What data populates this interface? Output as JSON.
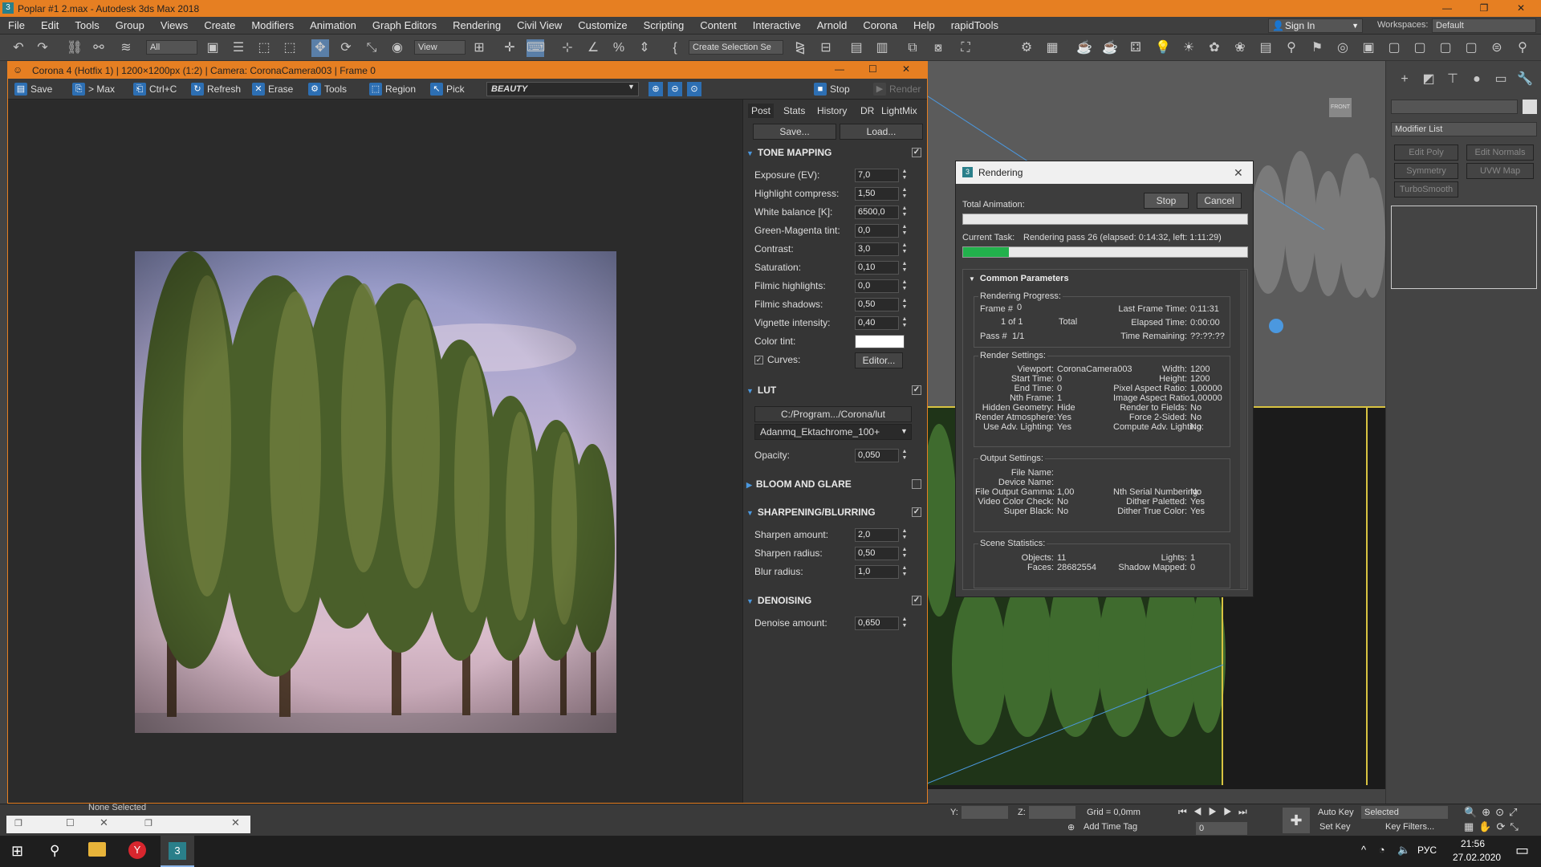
{
  "app": {
    "title": "Poplar #1 2.max - Autodesk 3ds Max 2018",
    "menus": [
      "File",
      "Edit",
      "Tools",
      "Group",
      "Views",
      "Create",
      "Modifiers",
      "Animation",
      "Graph Editors",
      "Rendering",
      "Civil View",
      "Customize",
      "Scripting",
      "Content",
      "Interactive",
      "Arnold",
      "Corona",
      "Help",
      "rapidTools"
    ],
    "sign_in": "Sign In",
    "workspaces_label": "Workspaces:",
    "workspace_value": "Default",
    "selection_filter": "All",
    "view_combo": "View",
    "selection_set": "Create Selection Se"
  },
  "vfb": {
    "title": "Corona 4 (Hotfix 1) | 1200×1200px (1:2) | Camera: CoronaCamera003 | Frame 0",
    "buttons": {
      "save": "Save",
      "max": "> Max",
      "ctrlc": "Ctrl+C",
      "refresh": "Refresh",
      "erase": "Erase",
      "tools": "Tools",
      "region": "Region",
      "pick": "Pick",
      "stop": "Stop",
      "render": "Render"
    },
    "channel": "BEAUTY",
    "tabs": [
      "Post",
      "Stats",
      "History",
      "DR",
      "LightMix"
    ],
    "save_btn": "Save...",
    "load_btn": "Load...",
    "tone_mapping": {
      "title": "TONE MAPPING",
      "rows": [
        {
          "label": "Exposure (EV):",
          "value": "7,0"
        },
        {
          "label": "Highlight compress:",
          "value": "1,50"
        },
        {
          "label": "White balance [K]:",
          "value": "6500,0"
        },
        {
          "label": "Green-Magenta tint:",
          "value": "0,0"
        },
        {
          "label": "Contrast:",
          "value": "3,0"
        },
        {
          "label": "Saturation:",
          "value": "0,10"
        },
        {
          "label": "Filmic highlights:",
          "value": "0,0"
        },
        {
          "label": "Filmic shadows:",
          "value": "0,50"
        },
        {
          "label": "Vignette intensity:",
          "value": "0,40"
        }
      ],
      "color_tint": "Color tint:",
      "curves": "Curves:",
      "editor": "Editor..."
    },
    "lut": {
      "title": "LUT",
      "path": "C:/Program.../Corona/lut",
      "file": "Adanmq_Ektachrome_100+",
      "opacity_label": "Opacity:",
      "opacity": "0,050"
    },
    "bloom": {
      "title": "BLOOM AND GLARE"
    },
    "sharpen": {
      "title": "SHARPENING/BLURRING",
      "rows": [
        {
          "label": "Sharpen amount:",
          "value": "2,0"
        },
        {
          "label": "Sharpen radius:",
          "value": "0,50"
        },
        {
          "label": "Blur radius:",
          "value": "1,0"
        }
      ]
    },
    "denoise": {
      "title": "DENOISING",
      "label": "Denoise amount:",
      "value": "0,650"
    }
  },
  "render_dialog": {
    "title": "Rendering",
    "stop": "Stop",
    "cancel": "Cancel",
    "total_anim": "Total Animation:",
    "current_task_label": "Current Task:",
    "current_task": "Rendering pass 26 (elapsed: 0:14:32, left: 1:11:29)",
    "current_progress": 0.16,
    "common_params": "Common Parameters",
    "progress_title": "Rendering Progress:",
    "frame": "Frame #",
    "frame_val": "0",
    "of": "1 of 1",
    "total": "Total",
    "pass": "Pass #",
    "pass_val": "1/1",
    "last_frame": "Last Frame Time:",
    "last_frame_val": "0:11:31",
    "elapsed": "Elapsed Time:",
    "elapsed_val": "0:00:00",
    "remaining": "Time Remaining:",
    "remaining_val": "??:??:??",
    "settings_title": "Render Settings:",
    "settings": [
      [
        "Viewport:",
        "CoronaCamera003",
        "Width:",
        "1200"
      ],
      [
        "Start Time:",
        "0",
        "Height:",
        "1200"
      ],
      [
        "End Time:",
        "0",
        "Pixel Aspect Ratio:",
        "1,00000"
      ],
      [
        "Nth Frame:",
        "1",
        "Image Aspect Ratio:",
        "1,00000"
      ],
      [
        "Hidden Geometry:",
        "Hide",
        "Render to Fields:",
        "No"
      ],
      [
        "Render Atmosphere:",
        "Yes",
        "Force 2-Sided:",
        "No"
      ],
      [
        "Use Adv. Lighting:",
        "Yes",
        "Compute Adv. Lighting:",
        "No"
      ]
    ],
    "output_title": "Output Settings:",
    "output": [
      [
        "File Name:",
        "",
        "",
        ""
      ],
      [
        "Device Name:",
        "",
        "",
        ""
      ],
      [
        "File Output Gamma:",
        "1,00",
        "Nth Serial Numbering:",
        "No"
      ],
      [
        "Video Color Check:",
        "No",
        "Dither Paletted:",
        "Yes"
      ],
      [
        "Super Black:",
        "No",
        "Dither True Color:",
        "Yes"
      ]
    ],
    "scene_title": "Scene Statistics:",
    "scene": [
      [
        "Objects:",
        "11",
        "Lights:",
        "1"
      ],
      [
        "Faces:",
        "28682554",
        "Shadow Mapped:",
        "0"
      ]
    ]
  },
  "cmd_panel": {
    "modifier_list": "Modifier List",
    "buttons": [
      "Edit Poly",
      "Edit Normals",
      "Symmetry",
      "UVW Map",
      "TurboSmooth"
    ]
  },
  "viewport": {
    "front_label": "FRONT"
  },
  "status": {
    "none_selected": "None Selected",
    "y_label": "Y:",
    "z_label": "Z:",
    "grid": "Grid = 0,0mm",
    "add_time_tag": "Add Time Tag",
    "auto_key": "Auto Key",
    "set_key": "Set Key",
    "selected": "Selected",
    "key_filters": "Key Filters...",
    "frame_field": "0"
  },
  "taskbar": {
    "lang": "РУС",
    "time": "21:56",
    "date": "27.02.2020"
  },
  "colors": {
    "accent": "#e67f22",
    "panel": "#353535",
    "progress": "#22b14c",
    "link_blue": "#4b98df"
  }
}
